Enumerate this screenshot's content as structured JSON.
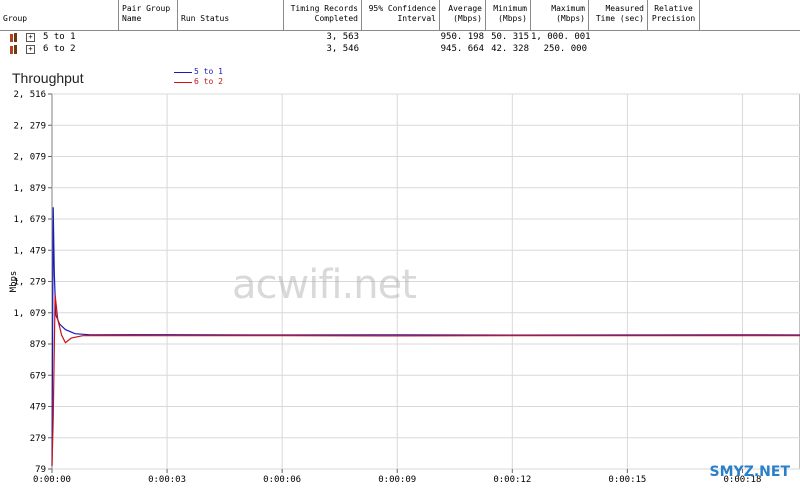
{
  "table": {
    "headers": [
      "Group",
      "Pair Group\nName",
      "Run Status",
      "Timing Records\nCompleted",
      "95% Confidence\nInterval",
      "Average\n(Mbps)",
      "Minimum\n(Mbps)",
      "Maximum\n(Mbps)",
      "Measured\nTime (sec)",
      "Relative\nPrecision"
    ],
    "rows": [
      {
        "group": "5 to 1",
        "pair_group_name": "",
        "run_status": "",
        "timing_records": "3, 563",
        "confidence": "",
        "average": "950. 198",
        "minimum": "50. 315",
        "maximum": "1, 000. 001",
        "measured_time": "",
        "relative_precision": ""
      },
      {
        "group": "6 to 2",
        "pair_group_name": "",
        "run_status": "",
        "timing_records": "3, 546",
        "confidence": "",
        "average": "945. 664",
        "minimum": "42. 328",
        "maximum": "250. 000",
        "measured_time": "",
        "relative_precision": ""
      }
    ]
  },
  "chart_data": {
    "type": "line",
    "title": "Throughput",
    "ylabel": "Mbps",
    "xlabel": "",
    "ylim": [
      79,
      2516
    ],
    "xlim": [
      0,
      19.5
    ],
    "y_ticks": [
      "2, 516",
      "2, 279",
      "2, 079",
      "1, 879",
      "1, 679",
      "1, 479",
      "1, 279",
      "1, 079",
      "879",
      "679",
      "479",
      "279",
      "79"
    ],
    "x_ticks": [
      "0:00:00",
      "0:00:03",
      "0:00:06",
      "0:00:09",
      "0:00:12",
      "0:00:15",
      "0:00:18"
    ],
    "x_tick_values": [
      0,
      3,
      6,
      9,
      12,
      15,
      18
    ],
    "grid": true,
    "series": [
      {
        "name": "5 to 1",
        "color": "#1a1ab8",
        "points": [
          [
            0,
            100
          ],
          [
            0.03,
            1780
          ],
          [
            0.06,
            1350
          ],
          [
            0.1,
            1080
          ],
          [
            0.2,
            1020
          ],
          [
            0.35,
            985
          ],
          [
            0.6,
            958
          ],
          [
            1,
            951
          ],
          [
            3,
            952
          ],
          [
            6,
            950
          ],
          [
            9,
            951
          ],
          [
            12,
            949
          ],
          [
            15,
            950
          ],
          [
            18,
            951
          ],
          [
            19.5,
            950
          ]
        ]
      },
      {
        "name": "6 to 2",
        "color": "#c81414",
        "points": [
          [
            0,
            100
          ],
          [
            0.03,
            400
          ],
          [
            0.08,
            1210
          ],
          [
            0.15,
            1050
          ],
          [
            0.25,
            950
          ],
          [
            0.35,
            900
          ],
          [
            0.5,
            930
          ],
          [
            0.8,
            945
          ],
          [
            1,
            946
          ],
          [
            3,
            945
          ],
          [
            6,
            946
          ],
          [
            9,
            944
          ],
          [
            12,
            946
          ],
          [
            15,
            945
          ],
          [
            18,
            946
          ],
          [
            19.5,
            945
          ]
        ]
      }
    ]
  },
  "watermark": "acwifi.net",
  "corner_mark": "SMYZ.NET"
}
